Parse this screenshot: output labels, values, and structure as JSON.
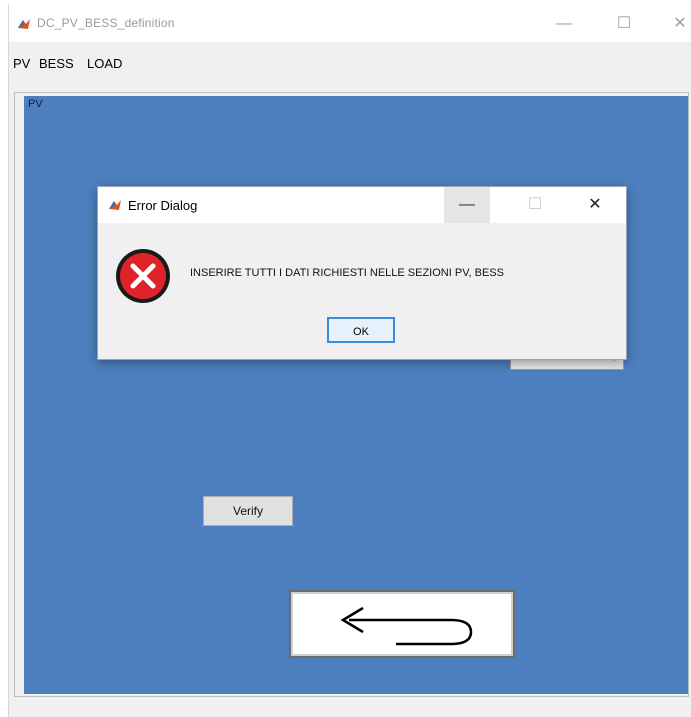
{
  "window": {
    "title": "DC_PV_BESS_definition",
    "minimize_icon": "minimize-icon",
    "maximize_icon": "maximize-icon",
    "close_icon": "close-icon",
    "minimize_glyph": "—",
    "maximize_glyph": "☐",
    "close_glyph": "✕"
  },
  "tabs": [
    {
      "label": "PV",
      "active": true
    },
    {
      "label": "BESS",
      "active": false
    },
    {
      "label": "LOAD",
      "active": false
    }
  ],
  "panel": {
    "title": "PV",
    "background": "#4d7fbe",
    "verify_label": "Verify",
    "back_icon": "return-arrow-icon"
  },
  "dialog": {
    "title": "Error Dialog",
    "message": "INSERIRE TUTTI I DATI RICHIESTI NELLE SEZIONI PV, BESS",
    "ok_label": "OK",
    "icon": "error-icon",
    "minimize_glyph": "—",
    "maximize_glyph": "☐",
    "close_glyph": "✕"
  }
}
